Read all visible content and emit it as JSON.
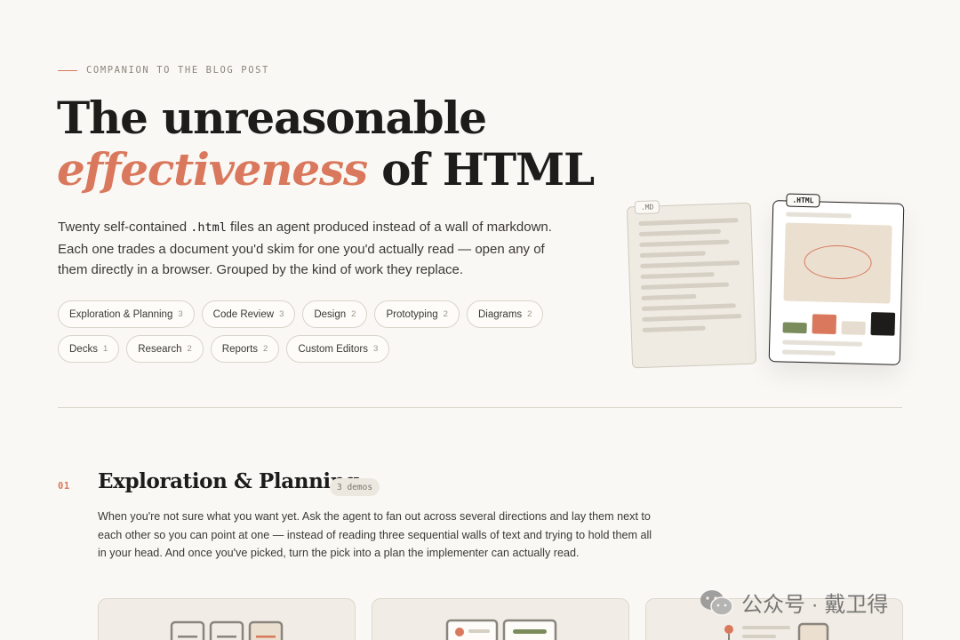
{
  "hero": {
    "eyebrow": "COMPANION TO THE BLOG POST",
    "title_line1": "The unreasonable",
    "title_accent": "effectiveness",
    "title_rest": " of HTML",
    "intro_before": "Twenty self-contained ",
    "intro_code": ".html",
    "intro_after": " files an agent produced instead of a wall of markdown. Each one trades a document you'd skim for one you'd actually read — open any of them directly in a browser. Grouped by the kind of work they replace."
  },
  "categories": [
    {
      "label": "Exploration & Planning",
      "count": "3"
    },
    {
      "label": "Code Review",
      "count": "3"
    },
    {
      "label": "Design",
      "count": "2"
    },
    {
      "label": "Prototyping",
      "count": "2"
    },
    {
      "label": "Diagrams",
      "count": "2"
    },
    {
      "label": "Decks",
      "count": "1"
    },
    {
      "label": "Research",
      "count": "2"
    },
    {
      "label": "Reports",
      "count": "2"
    },
    {
      "label": "Custom Editors",
      "count": "3"
    }
  ],
  "illustration": {
    "md_tag": ".MD",
    "html_tag": ".HTML",
    "swatch_colors": [
      "#7a8c5c",
      "#d9785c",
      "#e6ddd0",
      "#1d1c1a"
    ],
    "accent_color": "#d9785c"
  },
  "section": {
    "number": "01",
    "title": "Exploration & Planning",
    "badge": "3 demos",
    "description": "When you're not sure what you want yet. Ask the agent to fan out across several directions and lay them next to each other so you can point at one — instead of reading three sequential walls of text and trying to hold them all in your head. And once you've picked, turn the pick into a plan the implementer can actually read."
  },
  "watermark": {
    "text": "公众号 · 戴卫得"
  }
}
